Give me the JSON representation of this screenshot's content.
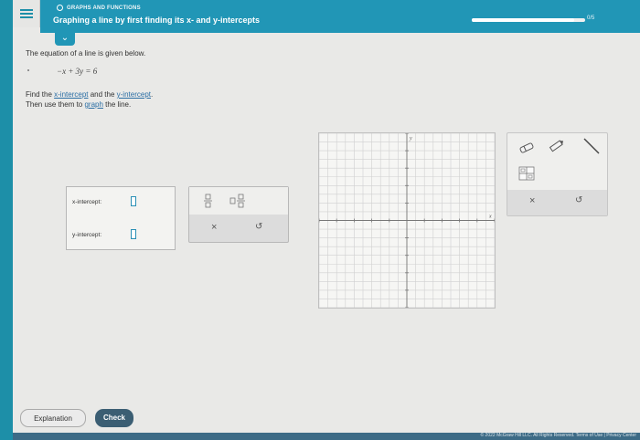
{
  "header": {
    "topic": "GRAPHS AND FUNCTIONS",
    "title": "Graphing a line by first finding its x- and y-intercepts",
    "progress_text": "0/5",
    "progress_fraction": 0.9
  },
  "problem": {
    "intro": "The equation of a line is given below.",
    "equation": "−x + 3y = 6",
    "instruction_prefix": "Find the ",
    "x_intercept_link": "x-intercept",
    "and_text": " and the ",
    "y_intercept_link": "y-intercept",
    "period": ".",
    "then_text": "Then use them to ",
    "graph_link": "graph",
    "then_suffix": " the line."
  },
  "answers": {
    "x_label": "x-intercept:",
    "y_label": "y-intercept:",
    "x_value": "",
    "y_value": ""
  },
  "tools": {
    "fraction_icon": "fraction-icon",
    "mixed_fraction_icon": "mixed-fraction-icon",
    "clear_symbol": "×",
    "undo_symbol": "↺"
  },
  "graph_tools": {
    "eraser_icon": "eraser-icon",
    "pencil_icon": "pencil-icon",
    "line_icon": "line-tool-icon",
    "grid_icon": "grid-icon",
    "clear_symbol": "×",
    "undo_symbol": "↺"
  },
  "graph": {
    "x_axis_label": "x",
    "y_axis_label": "y",
    "xlim": [
      -10,
      10
    ],
    "ylim": [
      -10,
      10
    ],
    "grid": true
  },
  "buttons": {
    "explanation": "Explanation",
    "check": "Check"
  },
  "footer": {
    "text": "© 2022 McGraw Hill LLC. All Rights Reserved.   Terms of Use   |   Privacy Center"
  },
  "colors": {
    "brand": "#2196b6",
    "check_button": "#3b5e73",
    "input_border": "#2a8fb5"
  }
}
